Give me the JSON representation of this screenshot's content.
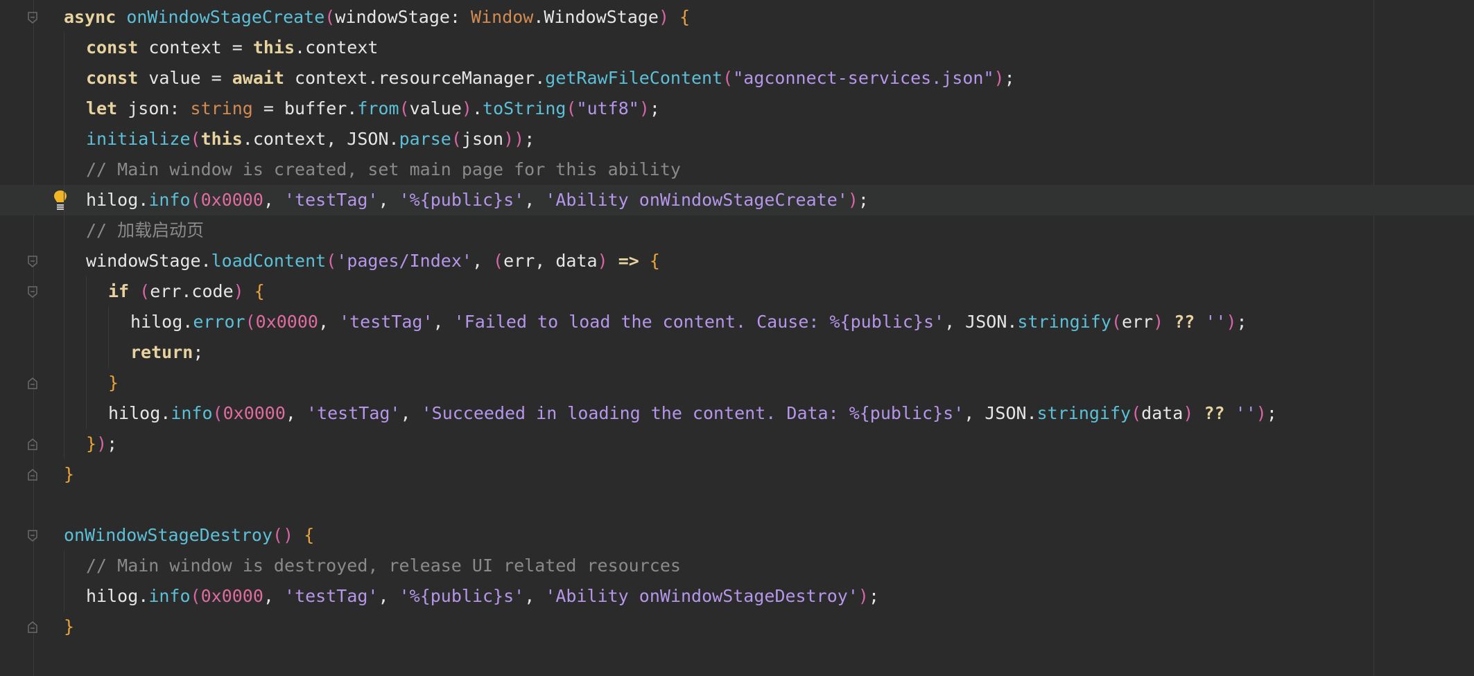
{
  "editor": {
    "lines": [
      {
        "indent": 0,
        "fold": "start",
        "tokens": [
          {
            "t": "async ",
            "c": "kw"
          },
          {
            "t": "onWindowStageCreate",
            "c": "fn"
          },
          {
            "t": "(",
            "c": "pn"
          },
          {
            "t": "windowStage",
            "c": "pl"
          },
          {
            "t": ": ",
            "c": "pl"
          },
          {
            "t": "Window",
            "c": "ty"
          },
          {
            "t": ".",
            "c": "pl"
          },
          {
            "t": "WindowStage",
            "c": "pl"
          },
          {
            "t": ") ",
            "c": "pn"
          },
          {
            "t": "{",
            "c": "br"
          }
        ]
      },
      {
        "indent": 1,
        "tokens": [
          {
            "t": "const ",
            "c": "kw"
          },
          {
            "t": "context = ",
            "c": "pl"
          },
          {
            "t": "this",
            "c": "kw"
          },
          {
            "t": ".context",
            "c": "pl"
          }
        ]
      },
      {
        "indent": 1,
        "tokens": [
          {
            "t": "const ",
            "c": "kw"
          },
          {
            "t": "value = ",
            "c": "pl"
          },
          {
            "t": "await ",
            "c": "kw"
          },
          {
            "t": "context.resourceManager.",
            "c": "pl"
          },
          {
            "t": "getRawFileContent",
            "c": "fn"
          },
          {
            "t": "(",
            "c": "pn"
          },
          {
            "t": "\"agconnect-services.json\"",
            "c": "str"
          },
          {
            "t": ")",
            "c": "pn"
          },
          {
            "t": ";",
            "c": "pl"
          }
        ]
      },
      {
        "indent": 1,
        "tokens": [
          {
            "t": "let ",
            "c": "kw"
          },
          {
            "t": "json: ",
            "c": "pl"
          },
          {
            "t": "string",
            "c": "ty"
          },
          {
            "t": " = buffer.",
            "c": "pl"
          },
          {
            "t": "from",
            "c": "fn"
          },
          {
            "t": "(",
            "c": "pn"
          },
          {
            "t": "value",
            "c": "pl"
          },
          {
            "t": ")",
            "c": "pn"
          },
          {
            "t": ".",
            "c": "pl"
          },
          {
            "t": "toString",
            "c": "fn"
          },
          {
            "t": "(",
            "c": "pn"
          },
          {
            "t": "\"utf8\"",
            "c": "str"
          },
          {
            "t": ")",
            "c": "pn"
          },
          {
            "t": ";",
            "c": "pl"
          }
        ]
      },
      {
        "indent": 1,
        "tokens": [
          {
            "t": "initialize",
            "c": "fn"
          },
          {
            "t": "(",
            "c": "pn"
          },
          {
            "t": "this",
            "c": "kw"
          },
          {
            "t": ".context, JSON.",
            "c": "pl"
          },
          {
            "t": "parse",
            "c": "fn"
          },
          {
            "t": "(",
            "c": "pn"
          },
          {
            "t": "json",
            "c": "pl"
          },
          {
            "t": "))",
            "c": "pn"
          },
          {
            "t": ";",
            "c": "pl"
          }
        ]
      },
      {
        "indent": 1,
        "tokens": [
          {
            "t": "// Main window is created, set main page for this ability",
            "c": "cm"
          }
        ]
      },
      {
        "indent": 1,
        "highlight": true,
        "bulb": true,
        "tokens": [
          {
            "t": "hilog.",
            "c": "pl"
          },
          {
            "t": "info",
            "c": "fn"
          },
          {
            "t": "(",
            "c": "pn"
          },
          {
            "t": "0x0000",
            "c": "num"
          },
          {
            "t": ", ",
            "c": "pl"
          },
          {
            "t": "'testTag'",
            "c": "str"
          },
          {
            "t": ", ",
            "c": "pl"
          },
          {
            "t": "'%{public}s'",
            "c": "str"
          },
          {
            "t": ", ",
            "c": "pl"
          },
          {
            "t": "'Ability onWindowStageCreate'",
            "c": "str"
          },
          {
            "t": ")",
            "c": "pn"
          },
          {
            "t": ";",
            "c": "pl"
          }
        ]
      },
      {
        "indent": 1,
        "tokens": [
          {
            "t": "// 加载启动页",
            "c": "cm"
          }
        ]
      },
      {
        "indent": 1,
        "fold": "start",
        "tokens": [
          {
            "t": "windowStage.",
            "c": "pl"
          },
          {
            "t": "loadContent",
            "c": "fn"
          },
          {
            "t": "(",
            "c": "pn"
          },
          {
            "t": "'pages/Index'",
            "c": "str"
          },
          {
            "t": ", ",
            "c": "pl"
          },
          {
            "t": "(",
            "c": "pn"
          },
          {
            "t": "err, data",
            "c": "pl"
          },
          {
            "t": ") ",
            "c": "pn"
          },
          {
            "t": "=> ",
            "c": "kw"
          },
          {
            "t": "{",
            "c": "br"
          }
        ]
      },
      {
        "indent": 2,
        "fold": "start",
        "tokens": [
          {
            "t": "if ",
            "c": "kw"
          },
          {
            "t": "(",
            "c": "pn"
          },
          {
            "t": "err.code",
            "c": "pl"
          },
          {
            "t": ") ",
            "c": "pn"
          },
          {
            "t": "{",
            "c": "br"
          }
        ]
      },
      {
        "indent": 3,
        "tokens": [
          {
            "t": "hilog.",
            "c": "pl"
          },
          {
            "t": "error",
            "c": "fn"
          },
          {
            "t": "(",
            "c": "pn"
          },
          {
            "t": "0x0000",
            "c": "num"
          },
          {
            "t": ", ",
            "c": "pl"
          },
          {
            "t": "'testTag'",
            "c": "str"
          },
          {
            "t": ", ",
            "c": "pl"
          },
          {
            "t": "'Failed to load the content. Cause: %{public}s'",
            "c": "str"
          },
          {
            "t": ", JSON.",
            "c": "pl"
          },
          {
            "t": "stringify",
            "c": "fn"
          },
          {
            "t": "(",
            "c": "pn"
          },
          {
            "t": "err",
            "c": "pl"
          },
          {
            "t": ") ",
            "c": "pn"
          },
          {
            "t": "?? ",
            "c": "kw"
          },
          {
            "t": "''",
            "c": "str"
          },
          {
            "t": ")",
            "c": "pn"
          },
          {
            "t": ";",
            "c": "pl"
          }
        ]
      },
      {
        "indent": 3,
        "tokens": [
          {
            "t": "return",
            "c": "kw"
          },
          {
            "t": ";",
            "c": "pl"
          }
        ]
      },
      {
        "indent": 2,
        "fold": "end",
        "tokens": [
          {
            "t": "}",
            "c": "br"
          }
        ]
      },
      {
        "indent": 2,
        "tokens": [
          {
            "t": "hilog.",
            "c": "pl"
          },
          {
            "t": "info",
            "c": "fn"
          },
          {
            "t": "(",
            "c": "pn"
          },
          {
            "t": "0x0000",
            "c": "num"
          },
          {
            "t": ", ",
            "c": "pl"
          },
          {
            "t": "'testTag'",
            "c": "str"
          },
          {
            "t": ", ",
            "c": "pl"
          },
          {
            "t": "'Succeeded in loading the content. Data: %{public}s'",
            "c": "str"
          },
          {
            "t": ", JSON.",
            "c": "pl"
          },
          {
            "t": "stringify",
            "c": "fn"
          },
          {
            "t": "(",
            "c": "pn"
          },
          {
            "t": "data",
            "c": "pl"
          },
          {
            "t": ") ",
            "c": "pn"
          },
          {
            "t": "?? ",
            "c": "kw"
          },
          {
            "t": "''",
            "c": "str"
          },
          {
            "t": ")",
            "c": "pn"
          },
          {
            "t": ";",
            "c": "pl"
          }
        ]
      },
      {
        "indent": 1,
        "fold": "end",
        "tokens": [
          {
            "t": "}",
            "c": "br"
          },
          {
            "t": ")",
            "c": "pn"
          },
          {
            "t": ";",
            "c": "pl"
          }
        ]
      },
      {
        "indent": 0,
        "fold": "end",
        "tokens": [
          {
            "t": "}",
            "c": "br"
          }
        ]
      },
      {
        "indent": 0,
        "tokens": []
      },
      {
        "indent": 0,
        "fold": "start",
        "tokens": [
          {
            "t": "onWindowStageDestroy",
            "c": "fn"
          },
          {
            "t": "() ",
            "c": "pn"
          },
          {
            "t": "{",
            "c": "br"
          }
        ]
      },
      {
        "indent": 1,
        "tokens": [
          {
            "t": "// Main window is destroyed, release UI related resources",
            "c": "cm"
          }
        ]
      },
      {
        "indent": 1,
        "tokens": [
          {
            "t": "hilog.",
            "c": "pl"
          },
          {
            "t": "info",
            "c": "fn"
          },
          {
            "t": "(",
            "c": "pn"
          },
          {
            "t": "0x0000",
            "c": "num"
          },
          {
            "t": ", ",
            "c": "pl"
          },
          {
            "t": "'testTag'",
            "c": "str"
          },
          {
            "t": ", ",
            "c": "pl"
          },
          {
            "t": "'%{public}s'",
            "c": "str"
          },
          {
            "t": ", ",
            "c": "pl"
          },
          {
            "t": "'Ability onWindowStageDestroy'",
            "c": "str"
          },
          {
            "t": ")",
            "c": "pn"
          },
          {
            "t": ";",
            "c": "pl"
          }
        ]
      },
      {
        "indent": 0,
        "fold": "end",
        "tokens": [
          {
            "t": "}",
            "c": "br"
          }
        ]
      }
    ]
  }
}
